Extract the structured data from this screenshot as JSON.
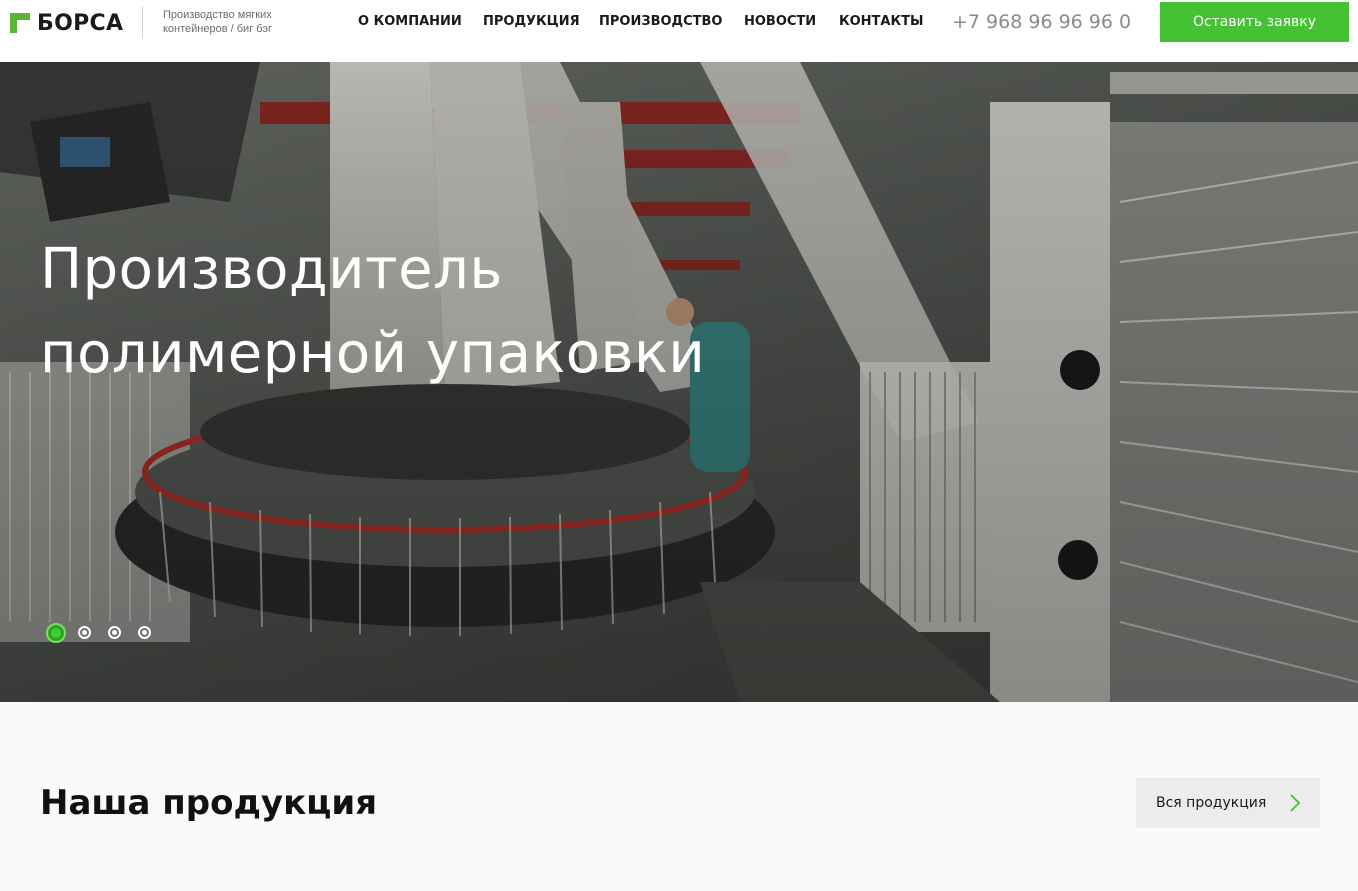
{
  "brand": {
    "name": "БОРСА",
    "tagline": "Производство мягких контейнеров / биг бэг",
    "accent": "#44c234"
  },
  "nav": {
    "items": [
      {
        "label": "О КОМПАНИИ"
      },
      {
        "label": "ПРОДУКЦИЯ"
      },
      {
        "label": "ПРОИЗВОДСТВО"
      },
      {
        "label": "НОВОСТИ"
      },
      {
        "label": "КОНТАКТЫ"
      }
    ],
    "phone": "+7 968 96 96 96 0",
    "cta_label": "Оставить заявку"
  },
  "hero": {
    "title_line1": "Производитель",
    "title_line2": "полимерной упаковки",
    "slides_total": 4,
    "active_slide": 1
  },
  "products": {
    "title": "Наша продукция",
    "all_label": "Вся продукция"
  }
}
